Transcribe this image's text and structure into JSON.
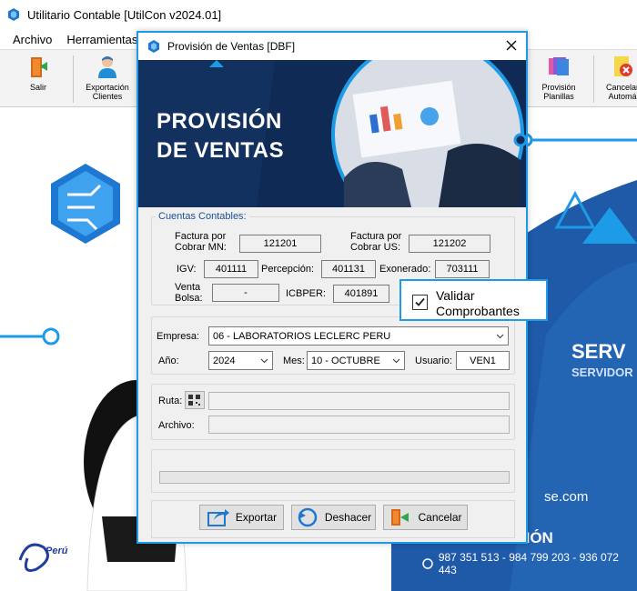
{
  "window": {
    "title": "Utilitario Contable [UtilCon v2024.01]"
  },
  "menu": {
    "items": [
      "Archivo",
      "Herramientas"
    ]
  },
  "toolbar": {
    "salir": "Salir",
    "exportacion": "Exportación Clientes",
    "provision_planillas": "Provisión Planillas",
    "cancelar": "Cancelar Automá"
  },
  "background": {
    "serv": "SERV",
    "servidor": "SERVIDOR",
    "web": "se.com",
    "info": "INFORMACIÓN",
    "phones": "987 351 513 - 984 799 203 - 936 072 443",
    "peru": "Perú"
  },
  "dialog": {
    "title": "Provisión de Ventas [DBF]",
    "banner": {
      "line1": "PROVISIÓN",
      "line2": "DE VENTAS"
    },
    "cuentas": {
      "legend": "Cuentas Contables:",
      "factura_mn_label": "Factura por Cobrar MN:",
      "factura_mn": "121201",
      "factura_us_label": "Factura por Cobrar US:",
      "factura_us": "121202",
      "igv_label": "IGV:",
      "igv": "401111",
      "percepcion_label": "Percepción:",
      "percepcion": "401131",
      "exonerado_label": "Exonerado:",
      "exonerado": "703111",
      "venta_bolsa_label": "Venta Bolsa:",
      "venta_bolsa": "-",
      "icbper_label": "ICBPER:",
      "icbper": "401891"
    },
    "empresa": {
      "label": "Empresa:",
      "value": "06 - LABORATORIOS LECLERC PERU",
      "anio_label": "Año:",
      "anio": "2024",
      "mes_label": "Mes:",
      "mes": "10 - OCTUBRE",
      "usuario_label": "Usuario:",
      "usuario": "VEN1"
    },
    "ruta": {
      "label": "Ruta:",
      "value": ""
    },
    "archivo": {
      "label": "Archivo:",
      "value": ""
    },
    "progress": 0,
    "buttons": {
      "exportar": "Exportar",
      "deshacer": "Deshacer",
      "cancelar": "Cancelar"
    }
  },
  "validar": {
    "line1": "Validar",
    "line2": "Comprobantes",
    "checked": true
  },
  "colors": {
    "accent": "#1e9be6",
    "navy": "#0f2a55",
    "bg_blue": "#1e5aa8"
  }
}
